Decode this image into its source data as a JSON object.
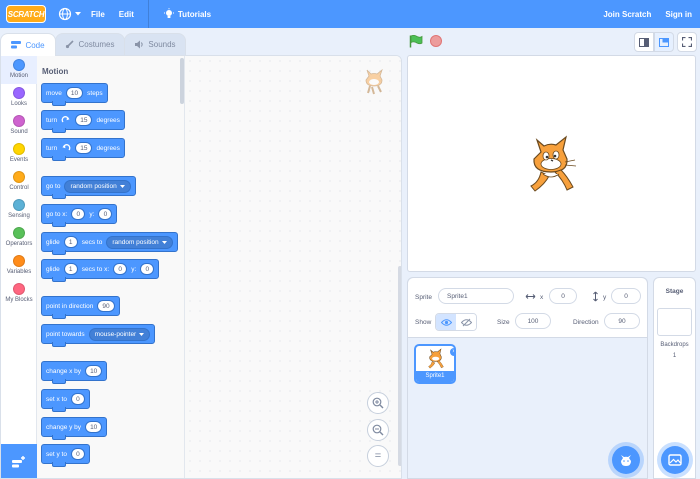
{
  "menubar": {
    "logo": "SCRATCH",
    "items": [
      "File",
      "Edit"
    ],
    "tutorials": "Tutorials",
    "join": "Join Scratch",
    "signin": "Sign in"
  },
  "tabs": {
    "code": "Code",
    "costumes": "Costumes",
    "sounds": "Sounds"
  },
  "categories": [
    {
      "label": "Motion",
      "color": "#4c97ff"
    },
    {
      "label": "Looks",
      "color": "#9966ff"
    },
    {
      "label": "Sound",
      "color": "#cf63cf"
    },
    {
      "label": "Events",
      "color": "#ffd500"
    },
    {
      "label": "Control",
      "color": "#ffab19"
    },
    {
      "label": "Sensing",
      "color": "#5cb1d6"
    },
    {
      "label": "Operators",
      "color": "#59c059"
    },
    {
      "label": "Variables",
      "color": "#ff8c1a"
    },
    {
      "label": "My Blocks",
      "color": "#ff6680"
    }
  ],
  "palette": {
    "title": "Motion",
    "blocks": {
      "move": {
        "a": "move",
        "v": "10",
        "b": "steps"
      },
      "turn_right": {
        "a": "turn",
        "v": "15",
        "b": "degrees"
      },
      "turn_left": {
        "a": "turn",
        "v": "15",
        "b": "degrees"
      },
      "goto": {
        "a": "go to",
        "dd": "random position"
      },
      "goto_xy": {
        "a": "go to x:",
        "x": "0",
        "b": "y:",
        "y": "0"
      },
      "glide": {
        "a": "glide",
        "v": "1",
        "b": "secs to",
        "dd": "random position"
      },
      "glide_xy": {
        "a": "glide",
        "v": "1",
        "b": "secs to x:",
        "x": "0",
        "c": "y:",
        "y": "0"
      },
      "point_dir": {
        "a": "point in direction",
        "v": "90"
      },
      "point_towards": {
        "a": "point towards",
        "dd": "mouse-pointer"
      },
      "change_x": {
        "a": "change x by",
        "v": "10"
      },
      "set_x": {
        "a": "set x to",
        "v": "0"
      },
      "change_y": {
        "a": "change y by",
        "v": "10"
      },
      "set_y": {
        "a": "set y to",
        "v": "0"
      }
    }
  },
  "zoom": {
    "in": "+",
    "out": "−",
    "reset": "="
  },
  "sprite_info": {
    "sprite_label": "Sprite",
    "sprite_name": "Sprite1",
    "x_label": "x",
    "x_value": "0",
    "y_label": "y",
    "y_value": "0",
    "show_label": "Show",
    "size_label": "Size",
    "size_value": "100",
    "direction_label": "Direction",
    "direction_value": "90"
  },
  "sprites": [
    {
      "name": "Sprite1"
    }
  ],
  "stage_pane": {
    "title": "Stage",
    "backdrops_label": "Backdrops",
    "backdrops_count": "1"
  },
  "colors": {
    "accent": "#4c97ff",
    "menubar": "#4c97ff",
    "motion": "#4c97ff"
  }
}
